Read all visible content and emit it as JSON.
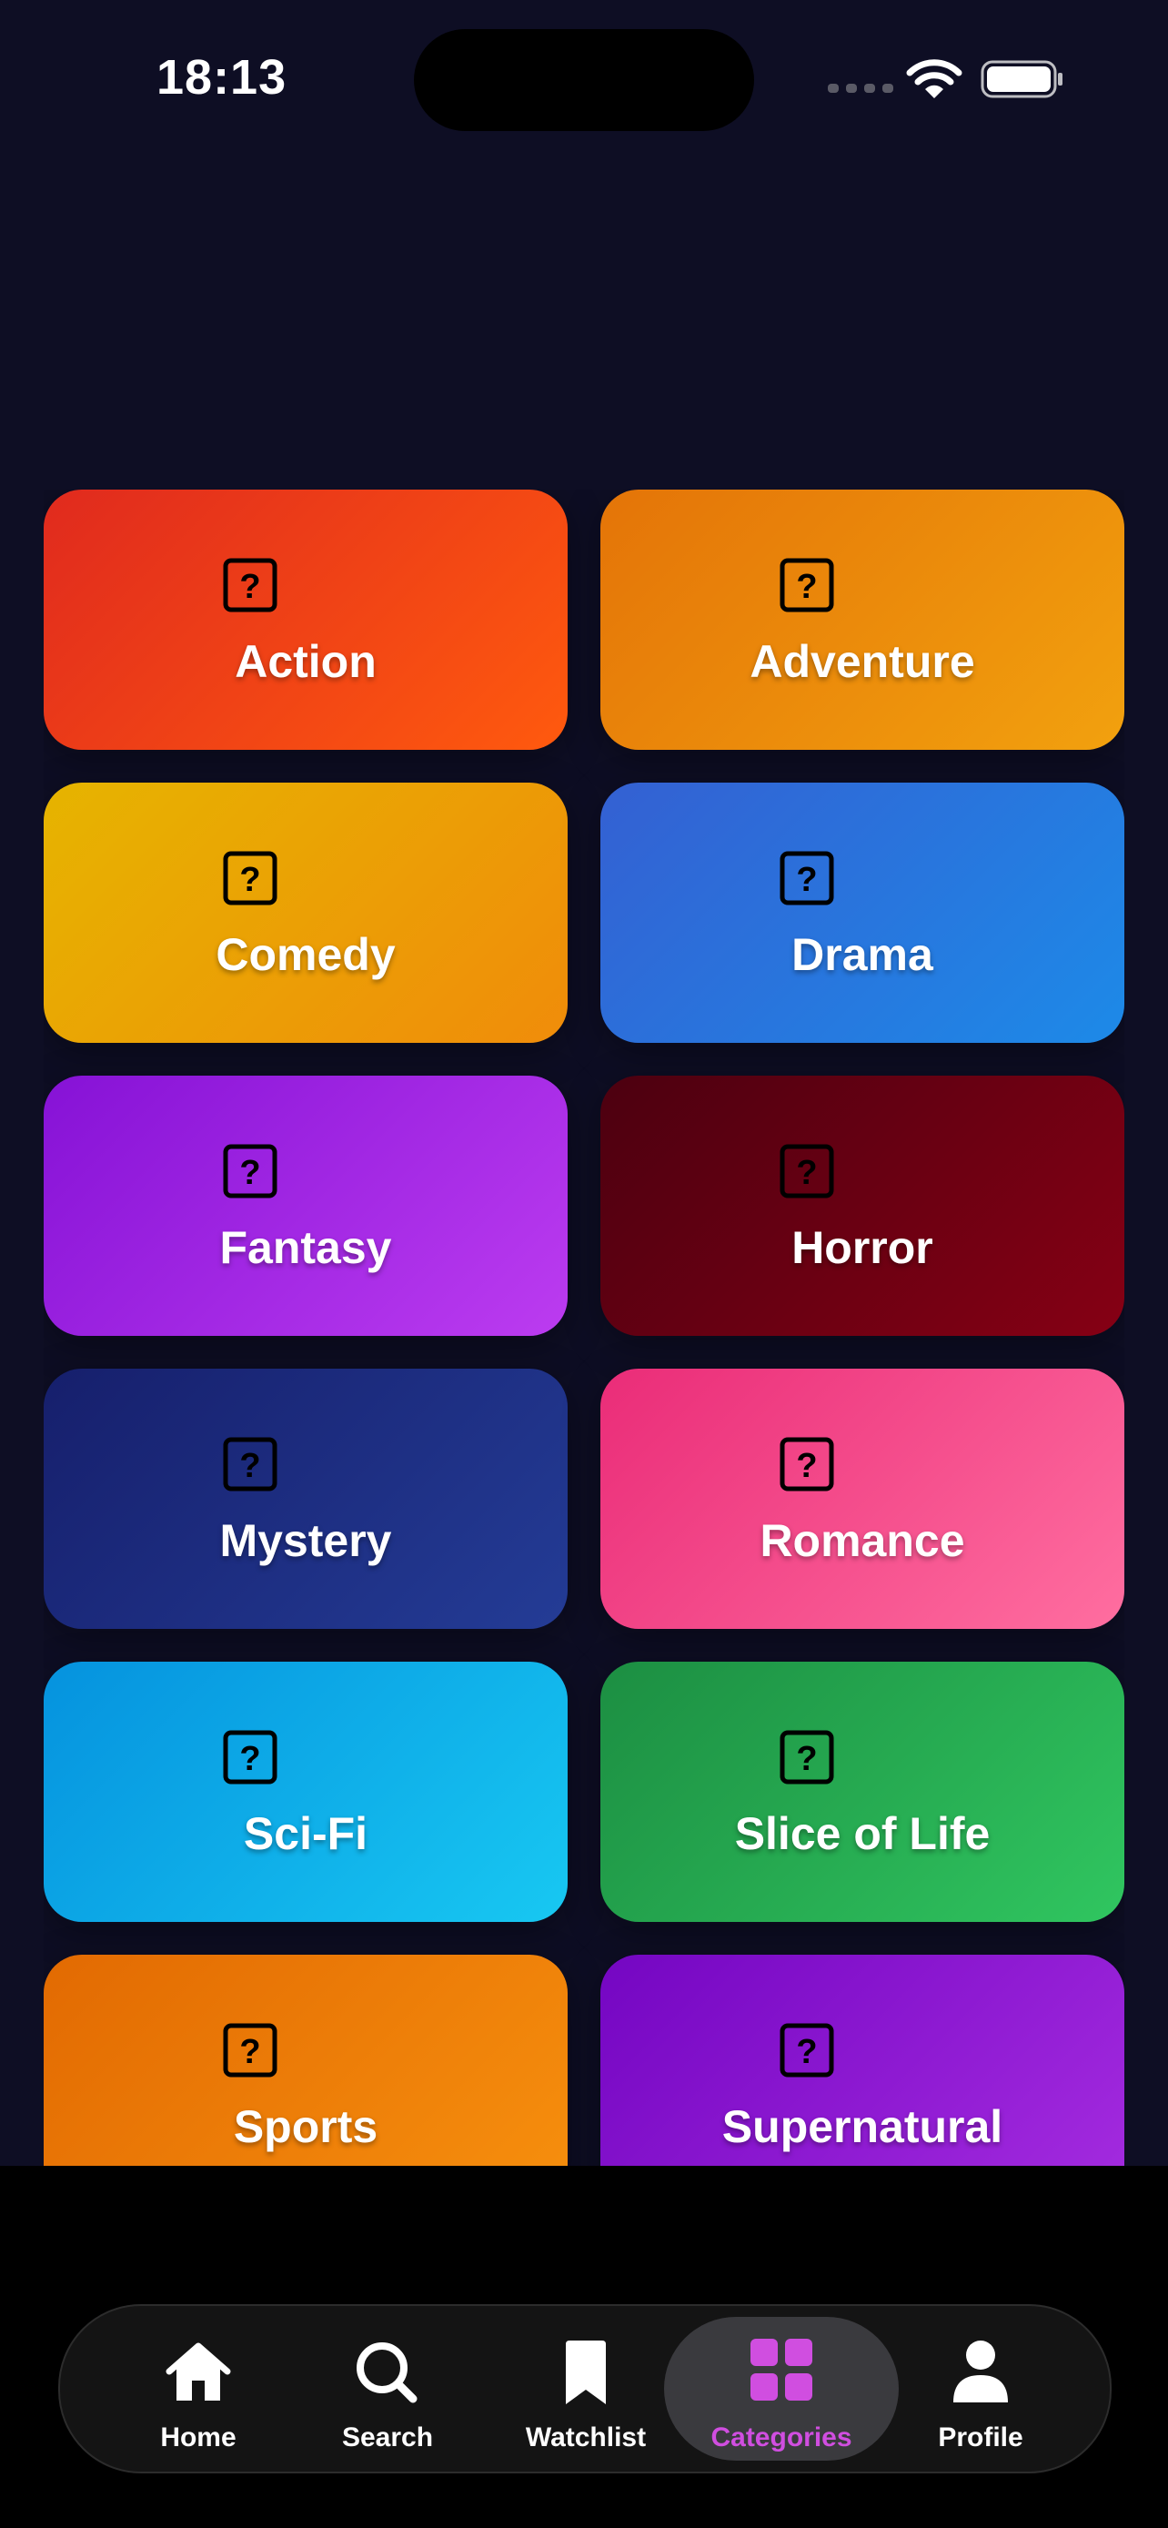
{
  "status_bar": {
    "time": "18:13"
  },
  "categories": [
    {
      "label": "Action",
      "from": "#e02a1e",
      "to": "#ff5a0e"
    },
    {
      "label": "Adventure",
      "from": "#e47408",
      "to": "#f2a10e"
    },
    {
      "label": "Comedy",
      "from": "#e6b400",
      "to": "#f08c0a"
    },
    {
      "label": "Drama",
      "from": "#3460d2",
      "to": "#1d8ae8"
    },
    {
      "label": "Fantasy",
      "from": "#8612d6",
      "to": "#bc3cf0"
    },
    {
      "label": "Horror",
      "from": "#4c0010",
      "to": "#860014"
    },
    {
      "label": "Mystery",
      "from": "#161f6c",
      "to": "#243c96"
    },
    {
      "label": "Romance",
      "from": "#ea2c78",
      "to": "#ff6ea0"
    },
    {
      "label": "Sci-Fi",
      "from": "#0592de",
      "to": "#18c8f2"
    },
    {
      "label": "Slice of Life",
      "from": "#1c8e42",
      "to": "#30c660"
    },
    {
      "label": "Sports",
      "from": "#e26a02",
      "to": "#f7900e"
    },
    {
      "label": "Supernatural",
      "from": "#7406c2",
      "to": "#a52ce0"
    }
  ],
  "tabbar": {
    "home": "Home",
    "search": "Search",
    "watchlist": "Watchlist",
    "categories": "Categories",
    "profile": "Profile",
    "active_color": "#d04ee0"
  }
}
